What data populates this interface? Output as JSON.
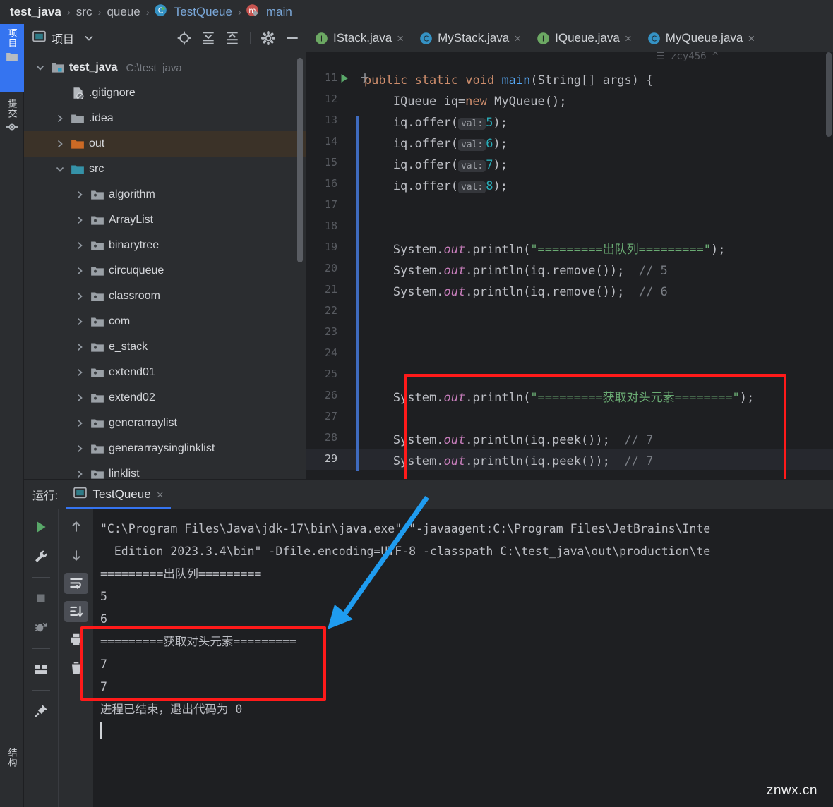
{
  "breadcrumb": {
    "items": [
      {
        "label": "test_java",
        "style": "bold",
        "icon": ""
      },
      {
        "label": "src",
        "style": "plain",
        "icon": ""
      },
      {
        "label": "queue",
        "style": "plain",
        "icon": ""
      },
      {
        "label": "TestQueue",
        "style": "link",
        "icon": "class-icon"
      },
      {
        "label": "main",
        "style": "link",
        "icon": "method-icon"
      }
    ],
    "separator": "›"
  },
  "toolstrip": {
    "tabs": [
      {
        "label": "项目",
        "icon": "project-folder-icon",
        "active": true
      },
      {
        "label": "提交",
        "icon": "commit-icon",
        "active": false
      }
    ],
    "bottom": [
      {
        "label": "结构",
        "icon": "structure-icon",
        "active": false
      }
    ]
  },
  "project_panel": {
    "title": "项目",
    "header_icons": [
      "project-dropdown-icon",
      "locate-icon",
      "expand-all-icon",
      "collapse-all-icon",
      "gear-icon",
      "minimize-icon"
    ],
    "tree": [
      {
        "label": "test_java",
        "path": "C:\\test_java",
        "indent": 0,
        "arrow": "down",
        "icon": "module-icon",
        "bold": true,
        "selected": false
      },
      {
        "label": ".gitignore",
        "path": "",
        "indent": 1,
        "arrow": "none",
        "icon": "gitignore-file-icon",
        "bold": false,
        "selected": false
      },
      {
        "label": ".idea",
        "path": "",
        "indent": 1,
        "arrow": "right",
        "icon": "folder-gray-icon",
        "bold": false,
        "selected": false
      },
      {
        "label": "out",
        "path": "",
        "indent": 1,
        "arrow": "right",
        "icon": "folder-orange-icon",
        "bold": false,
        "selected": true
      },
      {
        "label": "src",
        "path": "",
        "indent": 1,
        "arrow": "down",
        "icon": "folder-blue-icon",
        "bold": false,
        "selected": false
      },
      {
        "label": "algorithm",
        "path": "",
        "indent": 2,
        "arrow": "right",
        "icon": "package-icon",
        "bold": false,
        "selected": false
      },
      {
        "label": "ArrayList",
        "path": "",
        "indent": 2,
        "arrow": "right",
        "icon": "package-icon",
        "bold": false,
        "selected": false
      },
      {
        "label": "binarytree",
        "path": "",
        "indent": 2,
        "arrow": "right",
        "icon": "package-icon",
        "bold": false,
        "selected": false
      },
      {
        "label": "circuqueue",
        "path": "",
        "indent": 2,
        "arrow": "right",
        "icon": "package-icon",
        "bold": false,
        "selected": false
      },
      {
        "label": "classroom",
        "path": "",
        "indent": 2,
        "arrow": "right",
        "icon": "package-icon",
        "bold": false,
        "selected": false
      },
      {
        "label": "com",
        "path": "",
        "indent": 2,
        "arrow": "right",
        "icon": "package-icon",
        "bold": false,
        "selected": false
      },
      {
        "label": "e_stack",
        "path": "",
        "indent": 2,
        "arrow": "right",
        "icon": "package-icon",
        "bold": false,
        "selected": false
      },
      {
        "label": "extend01",
        "path": "",
        "indent": 2,
        "arrow": "right",
        "icon": "package-icon",
        "bold": false,
        "selected": false
      },
      {
        "label": "extend02",
        "path": "",
        "indent": 2,
        "arrow": "right",
        "icon": "package-icon",
        "bold": false,
        "selected": false
      },
      {
        "label": "generarraylist",
        "path": "",
        "indent": 2,
        "arrow": "right",
        "icon": "package-icon",
        "bold": false,
        "selected": false
      },
      {
        "label": "generarraysinglinklist",
        "path": "",
        "indent": 2,
        "arrow": "right",
        "icon": "package-icon",
        "bold": false,
        "selected": false
      },
      {
        "label": "linklist",
        "path": "",
        "indent": 2,
        "arrow": "right",
        "icon": "package-icon",
        "bold": false,
        "selected": false
      }
    ]
  },
  "editor_tabs": [
    {
      "label": "IStack.java",
      "icon": "interface-icon",
      "icon_letter": "I",
      "icon_color": "#6ca863",
      "close": "×"
    },
    {
      "label": "MyStack.java",
      "icon": "class-icon",
      "icon_letter": "C",
      "icon_color": "#3592c4",
      "close": "×"
    },
    {
      "label": "IQueue.java",
      "icon": "interface-icon",
      "icon_letter": "I",
      "icon_color": "#6ca863",
      "close": "×"
    },
    {
      "label": "MyQueue.java",
      "icon": "class-icon",
      "icon_letter": "C",
      "icon_color": "#3592c4",
      "close": "×"
    }
  ],
  "editor": {
    "author_hint": "☰ zcy456 ^",
    "first_line": 11,
    "last_line": 29,
    "current_line": 29,
    "lines": [
      {
        "n": 11,
        "segs": [
          {
            "t": "        ",
            "c": "pl"
          },
          {
            "t": "public",
            "c": "kw"
          },
          {
            "t": " ",
            "c": "pl"
          },
          {
            "t": "static",
            "c": "kw"
          },
          {
            "t": " ",
            "c": "pl"
          },
          {
            "t": "void",
            "c": "kw"
          },
          {
            "t": " ",
            "c": "pl"
          },
          {
            "t": "main",
            "c": "fn"
          },
          {
            "t": "(String[] args) {",
            "c": "pl"
          }
        ]
      },
      {
        "n": 12,
        "segs": [
          {
            "t": "            IQueue iq=",
            "c": "pl"
          },
          {
            "t": "new",
            "c": "kw"
          },
          {
            "t": " MyQueue();",
            "c": "pl"
          }
        ]
      },
      {
        "n": 13,
        "segs": [
          {
            "t": "            iq.offer(",
            "c": "pl"
          },
          {
            "t": "val:",
            "c": "hint"
          },
          {
            "t": "5",
            "c": "num"
          },
          {
            "t": ");",
            "c": "pl"
          }
        ]
      },
      {
        "n": 14,
        "segs": [
          {
            "t": "            iq.offer(",
            "c": "pl"
          },
          {
            "t": "val:",
            "c": "hint"
          },
          {
            "t": "6",
            "c": "num"
          },
          {
            "t": ");",
            "c": "pl"
          }
        ]
      },
      {
        "n": 15,
        "segs": [
          {
            "t": "            iq.offer(",
            "c": "pl"
          },
          {
            "t": "val:",
            "c": "hint"
          },
          {
            "t": "7",
            "c": "num"
          },
          {
            "t": ");",
            "c": "pl"
          }
        ]
      },
      {
        "n": 16,
        "segs": [
          {
            "t": "            iq.offer(",
            "c": "pl"
          },
          {
            "t": "val:",
            "c": "hint"
          },
          {
            "t": "8",
            "c": "num"
          },
          {
            "t": ");",
            "c": "pl"
          }
        ]
      },
      {
        "n": 17,
        "segs": []
      },
      {
        "n": 18,
        "segs": []
      },
      {
        "n": 19,
        "segs": [
          {
            "t": "            System.",
            "c": "pl"
          },
          {
            "t": "out",
            "c": "fld"
          },
          {
            "t": ".println(",
            "c": "pl"
          },
          {
            "t": "\"=========出队列=========\"",
            "c": "str"
          },
          {
            "t": ");",
            "c": "pl"
          }
        ]
      },
      {
        "n": 20,
        "segs": [
          {
            "t": "            System.",
            "c": "pl"
          },
          {
            "t": "out",
            "c": "fld"
          },
          {
            "t": ".println(iq.remove());  ",
            "c": "pl"
          },
          {
            "t": "// 5",
            "c": "cmt"
          }
        ]
      },
      {
        "n": 21,
        "segs": [
          {
            "t": "            System.",
            "c": "pl"
          },
          {
            "t": "out",
            "c": "fld"
          },
          {
            "t": ".println(iq.remove());  ",
            "c": "pl"
          },
          {
            "t": "// 6",
            "c": "cmt"
          }
        ]
      },
      {
        "n": 22,
        "segs": []
      },
      {
        "n": 23,
        "segs": []
      },
      {
        "n": 24,
        "segs": []
      },
      {
        "n": 25,
        "segs": []
      },
      {
        "n": 26,
        "segs": [
          {
            "t": "            System.",
            "c": "pl"
          },
          {
            "t": "out",
            "c": "fld"
          },
          {
            "t": ".println(",
            "c": "pl"
          },
          {
            "t": "\"=========获取对头元素========\"",
            "c": "str"
          },
          {
            "t": ");",
            "c": "pl"
          }
        ]
      },
      {
        "n": 27,
        "segs": []
      },
      {
        "n": 28,
        "segs": [
          {
            "t": "            System.",
            "c": "pl"
          },
          {
            "t": "out",
            "c": "fld"
          },
          {
            "t": ".println(iq.peek());  ",
            "c": "pl"
          },
          {
            "t": "// 7",
            "c": "cmt"
          }
        ]
      },
      {
        "n": 29,
        "segs": [
          {
            "t": "            System.",
            "c": "pl"
          },
          {
            "t": "out",
            "c": "fld"
          },
          {
            "t": ".println(iq.peek());  ",
            "c": "pl"
          },
          {
            "t": "// 7",
            "c": "cmt"
          }
        ]
      }
    ]
  },
  "run_panel": {
    "label": "运行:",
    "tab_label": "TestQueue",
    "tab_close": "×",
    "toolbar_left": [
      "run-icon",
      "wrench-icon",
      "stop-icon",
      "rerun-failed-icon",
      "layout-icon",
      "pin-icon"
    ],
    "toolbar_right": [
      "arrow-up-icon",
      "arrow-down-icon",
      "soft-wrap-icon",
      "scroll-to-end-icon",
      "print-icon",
      "trash-icon"
    ],
    "console_lines": [
      "\"C:\\Program Files\\Java\\jdk-17\\bin\\java.exe\" \"-javaagent:C:\\Program Files\\JetBrains\\Inte",
      "  Edition 2023.3.4\\bin\" -Dfile.encoding=UTF-8 -classpath C:\\test_java\\out\\production\\te",
      "=========出队列=========",
      "5",
      "6",
      "=========获取对头元素=========",
      "7",
      "7",
      "",
      "进程已结束，退出代码为 0"
    ]
  },
  "annotations": {
    "red_box_color": "#ff1a1a",
    "arrow_color": "#1f9cf0",
    "watermark": "znwx.cn"
  }
}
